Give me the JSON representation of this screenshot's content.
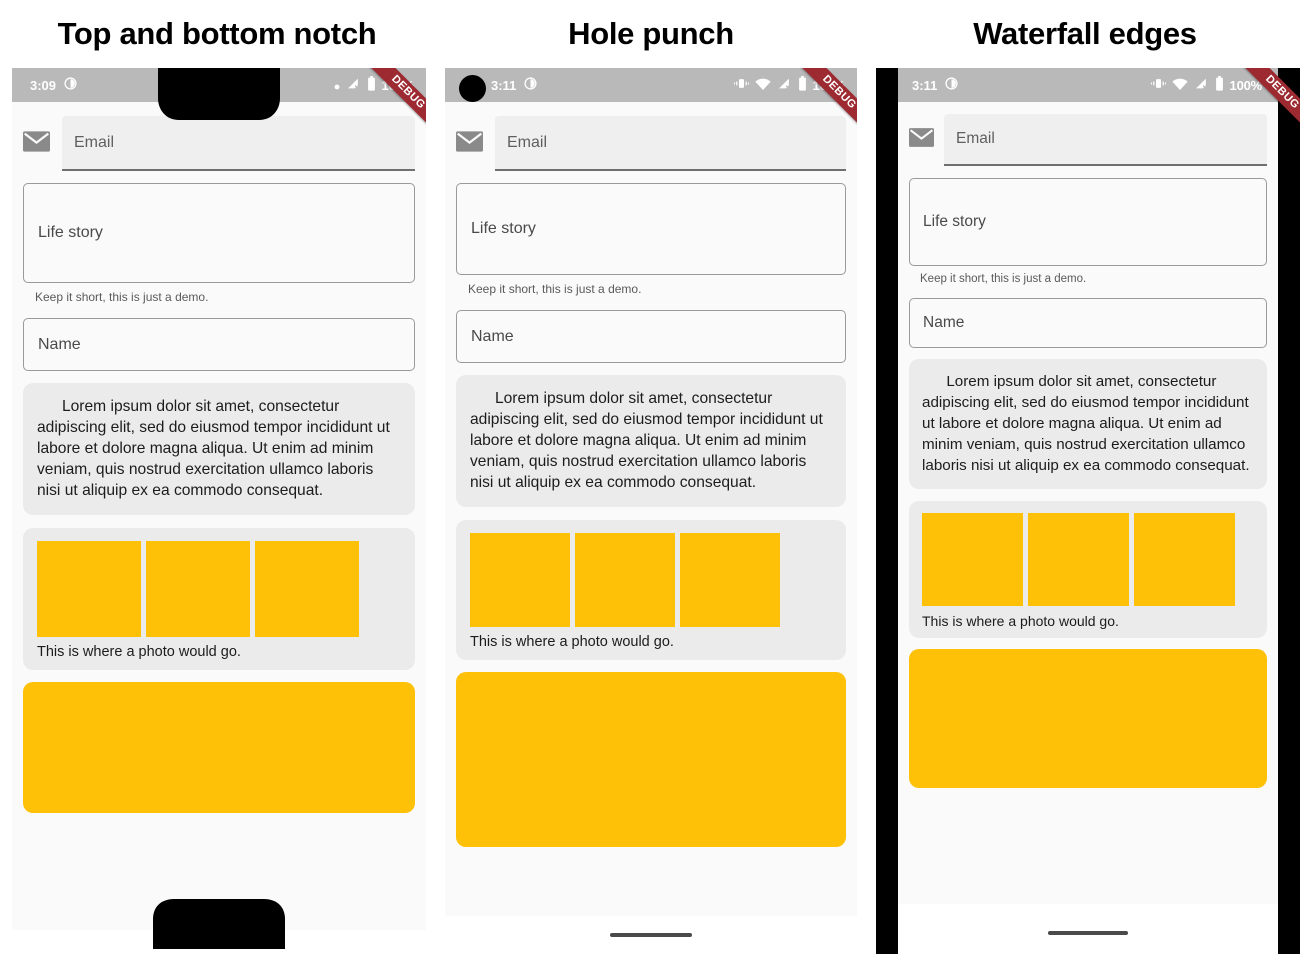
{
  "page": {
    "background": "#ffffff",
    "accent_amber": "#ffc107",
    "ribbon_color": "#9d2a31",
    "statusbar_color": "#b9b9b9"
  },
  "panels": [
    {
      "title": "Top and bottom notch",
      "statusbar": {
        "time": "3:09",
        "left_icons": [
          "dnd-icon"
        ],
        "right_icons": [
          "dot-icon",
          "cell-signal-off-icon",
          "battery-icon"
        ],
        "battery_percent": "100%"
      },
      "ribbon_label": "DEBUG",
      "form": {
        "email_icon": "mail-icon",
        "email_placeholder": "Email",
        "life_story_placeholder": "Life story",
        "helper_text": "Keep it short, this is just a demo.",
        "name_placeholder": "Name",
        "paragraph": "Lorem ipsum dolor sit amet, consectetur adipiscing elit, sed do eiusmod tempor incididunt ut labore et dolore magna aliqua. Ut enim ad minim veniam, quis nostrud exercitation ullamco laboris nisi ut aliquip ex ea commodo consequat.",
        "photo_caption": "This is where a photo would go.",
        "photo_count": 3
      },
      "cutouts": {
        "type": "notch-top-bottom"
      }
    },
    {
      "title": "Hole punch",
      "statusbar": {
        "time": "3:11",
        "left_icons": [
          "dnd-icon"
        ],
        "right_icons": [
          "vibrate-icon",
          "wifi-icon",
          "cell-signal-off-icon",
          "battery-icon"
        ],
        "battery_percent": "100%"
      },
      "ribbon_label": "DEBUG",
      "form": {
        "email_icon": "mail-icon",
        "email_placeholder": "Email",
        "life_story_placeholder": "Life story",
        "helper_text": "Keep it short, this is just a demo.",
        "name_placeholder": "Name",
        "paragraph": "Lorem ipsum dolor sit amet, consectetur adipiscing elit, sed do eiusmod tempor incididunt ut labore et dolore magna aliqua. Ut enim ad minim veniam, quis nostrud exercitation ullamco laboris nisi ut aliquip ex ea commodo consequat.",
        "photo_caption": "This is where a photo would go.",
        "photo_count": 3
      },
      "cutouts": {
        "type": "hole-punch"
      }
    },
    {
      "title": "Waterfall edges",
      "statusbar": {
        "time": "3:11",
        "left_icons": [
          "dnd-icon"
        ],
        "right_icons": [
          "vibrate-icon",
          "wifi-icon",
          "cell-signal-off-icon",
          "battery-icon"
        ],
        "battery_percent": "100%"
      },
      "ribbon_label": "DEBUG",
      "form": {
        "email_icon": "mail-icon",
        "email_placeholder": "Email",
        "life_story_placeholder": "Life story",
        "helper_text": "Keep it short, this is just a demo.",
        "name_placeholder": "Name",
        "paragraph": "Lorem ipsum dolor sit amet, consectetur adipiscing elit, sed do eiusmod tempor incididunt ut labore et dolore magna aliqua. Ut enim ad minim veniam, quis nostrud exercitation ullamco laboris nisi ut aliquip ex ea commodo consequat.",
        "photo_caption": "This is where a photo would go.",
        "photo_count": 3
      },
      "cutouts": {
        "type": "waterfall-edges"
      }
    }
  ]
}
